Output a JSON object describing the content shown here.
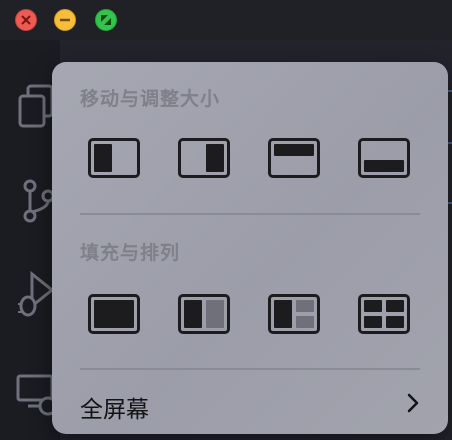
{
  "window_controls": {
    "close": "close-icon",
    "minimize": "minimize-icon",
    "zoom": "zoom-icon"
  },
  "colors": {
    "close": "#ee5b55",
    "minimize": "#f6be3b",
    "zoom": "#34c34c",
    "popover_bg": "#a2a3ad",
    "section_title": "#7f8089"
  },
  "activity_bar": {
    "items": [
      "files-icon",
      "source-control-icon",
      "run-debug-icon",
      "remote-explorer-icon"
    ]
  },
  "popover": {
    "move_resize": {
      "title": "移动与调整大小",
      "options": [
        "left-half-icon",
        "right-half-icon",
        "top-half-icon",
        "bottom-half-icon"
      ]
    },
    "fill_arrange": {
      "title": "填充与排列",
      "options": [
        "fill-icon",
        "split-icon",
        "three-pane-icon",
        "grid-icon"
      ]
    },
    "fullscreen": {
      "label": "全屏幕",
      "chevron": "chevron-right-icon"
    }
  }
}
